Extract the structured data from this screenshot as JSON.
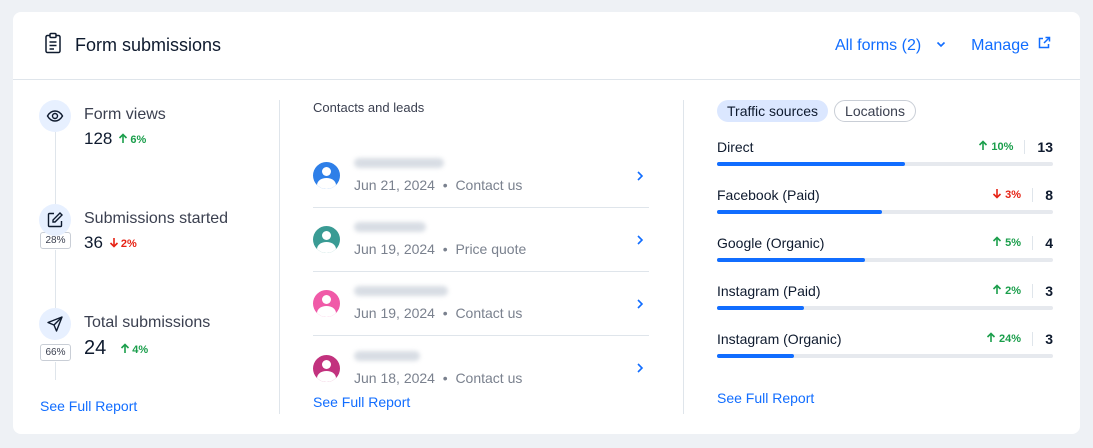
{
  "header": {
    "title": "Form submissions",
    "all_forms_label": "All forms (2)",
    "manage_label": "Manage"
  },
  "funnel": {
    "steps": [
      {
        "label": "Form views",
        "value": "128",
        "trend": "6%",
        "direction": "up"
      },
      {
        "label": "Submissions started",
        "value": "36",
        "trend": "2%",
        "direction": "down"
      },
      {
        "label": "Total submissions",
        "value": "24",
        "trend": "4%",
        "direction": "up"
      }
    ],
    "conversions": [
      "28%",
      "66%"
    ],
    "see_report": "See Full Report"
  },
  "contacts": {
    "title": "Contacts and leads",
    "items": [
      {
        "date": "Jun 21, 2024",
        "source": "Contact us",
        "avatar_color": "#2e7fe8"
      },
      {
        "date": "Jun 19, 2024",
        "source": "Price quote",
        "avatar_color": "#3a9b94"
      },
      {
        "date": "Jun 19, 2024",
        "source": "Contact us",
        "avatar_color": "#f05aa8"
      },
      {
        "date": "Jun 18, 2024",
        "source": "Contact us",
        "avatar_color": "#c2327e"
      }
    ],
    "see_report": "See Full Report"
  },
  "traffic": {
    "tabs": [
      "Traffic sources",
      "Locations"
    ],
    "active_tab": 0,
    "sources": [
      {
        "name": "Direct",
        "trend": "10%",
        "direction": "up",
        "count": "13",
        "share": 0.56
      },
      {
        "name": "Facebook (Paid)",
        "trend": "3%",
        "direction": "down",
        "count": "8",
        "share": 0.49
      },
      {
        "name": "Google (Organic)",
        "trend": "5%",
        "direction": "up",
        "count": "4",
        "share": 0.44
      },
      {
        "name": "Instagram (Paid)",
        "trend": "2%",
        "direction": "up",
        "count": "3",
        "share": 0.26
      },
      {
        "name": "Instagram (Organic)",
        "trend": "24%",
        "direction": "up",
        "count": "3",
        "share": 0.23
      }
    ],
    "see_report": "See Full Report"
  },
  "colors": {
    "accent": "#116dff",
    "trend_up": "#1a9e4b",
    "trend_down": "#e62214"
  }
}
